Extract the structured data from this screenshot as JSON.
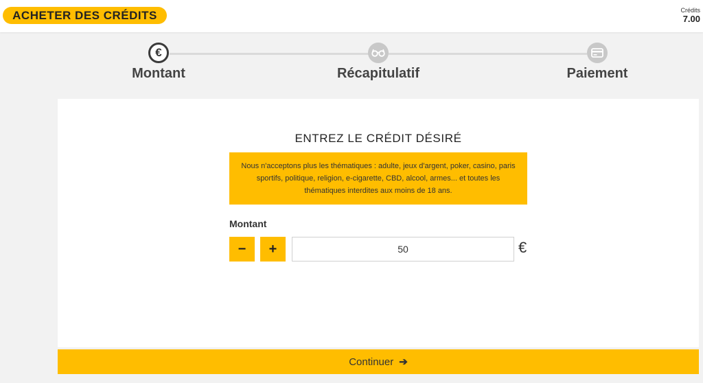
{
  "header": {
    "title": "ACHETER DES CRÉDITS",
    "credits_label": "Crédits",
    "credits_value": "7.00"
  },
  "steps": [
    {
      "label": "Montant",
      "icon": "euro-icon",
      "icon_glyph": "€",
      "state": "active"
    },
    {
      "label": "Récapitulatif",
      "icon": "glasses-icon",
      "state": "inactive"
    },
    {
      "label": "Paiement",
      "icon": "credit-card-icon",
      "state": "inactive"
    }
  ],
  "main": {
    "title": "ENTREZ LE CRÉDIT DÉSIRÉ",
    "warning": "Nous n'acceptons plus les thématiques : adulte, jeux d'argent, poker, casino, paris sportifs, politique, religion, e-cigarette, CBD, alcool, armes... et toutes les thématiques interdites aux moins de 18 ans.",
    "amount_label": "Montant",
    "decrement_label": "−",
    "increment_label": "+",
    "amount_value": "50",
    "currency": "€",
    "continue_label": "Continuer",
    "continue_arrow": "➔"
  },
  "colors": {
    "accent": "#ffbd00",
    "background": "#f2f2f2",
    "step_inactive": "#c8c8c8",
    "step_active_border": "#3a3a3a"
  }
}
